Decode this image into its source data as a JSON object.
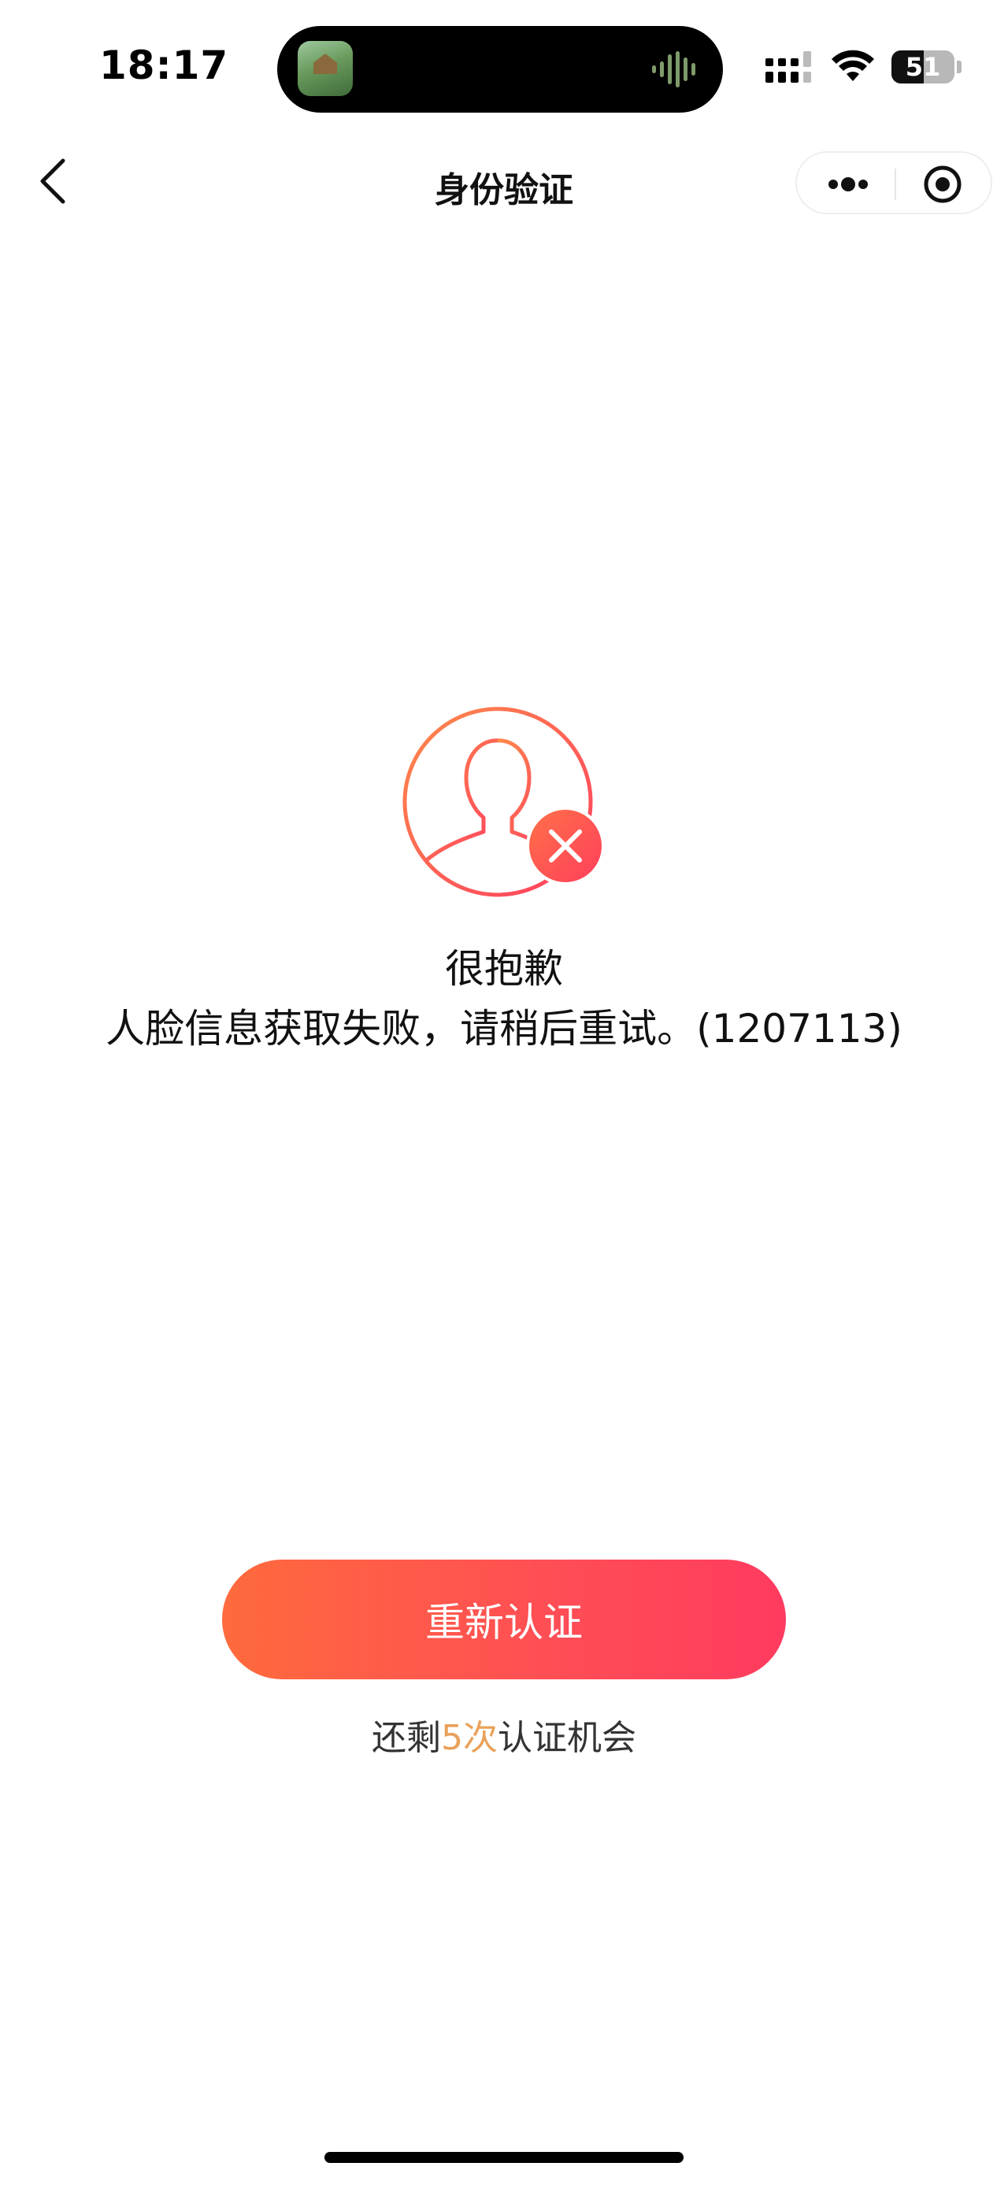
{
  "status_bar": {
    "time": "18:17",
    "battery_level": "51",
    "battery_fraction": 0.51
  },
  "nav": {
    "title": "身份验证",
    "back_icon": "chevron-left-icon",
    "more_icon": "more-dots-icon",
    "close_icon": "target-circle-icon"
  },
  "result": {
    "icon": "user-error-icon",
    "title": "很抱歉",
    "message": "人脸信息获取失败，请稍后重试。(1207113)"
  },
  "actions": {
    "retry_label": "重新认证",
    "remaining_prefix": "还剩",
    "remaining_count": "5次",
    "remaining_suffix": "认证机会"
  },
  "colors": {
    "accent_start": "#ff6a3d",
    "accent_end": "#ff3b5f",
    "count_color": "#e9a15a"
  }
}
